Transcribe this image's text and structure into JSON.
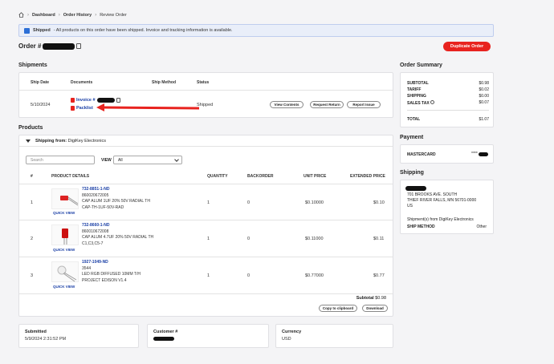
{
  "breadcrumb": {
    "home_icon": "home-icon",
    "dashboard": "Dashboard",
    "order_history": "Order History",
    "current": "Review Order"
  },
  "banner": {
    "status": "Shipped",
    "message": "- All products on this order have been shipped. Invoice and tracking information is available."
  },
  "order": {
    "title_prefix": "Order #",
    "duplicate_label": "Duplicate Order"
  },
  "shipments": {
    "title": "Shipments",
    "headers": {
      "ship_date": "Ship Date",
      "documents": "Documents",
      "ship_method": "Ship Method",
      "status": "Status"
    },
    "row": {
      "ship_date": "5/10/2024",
      "invoice_label": "Invoice #",
      "packlist_label": "Packlist",
      "status": "Shipped",
      "btn_view": "View Contents",
      "btn_return": "Request Return",
      "btn_issue": "Report Issue"
    }
  },
  "products": {
    "title": "Products",
    "shipping_from": "Shipping from:",
    "shipping_from_value": "DigiKey Electronics",
    "search_placeholder": "Search",
    "view_label": "VIEW",
    "view_value": "All",
    "headers": {
      "num": "#",
      "details": "PRODUCT DETAILS",
      "qty": "QUANTITY",
      "backorder": "BACKORDER",
      "unit": "UNIT PRICE",
      "ext": "EXTENDED PRICE"
    },
    "quick_view": "QUICK VIEW",
    "rows": [
      {
        "num": "1",
        "pn": "732-8851-1-ND",
        "mfr": "860020672005",
        "desc": "CAP ALUM 1UF 20% 50V RADIAL TH",
        "cust": "CAP-TH-1UF-50V-RAD",
        "qty": "1",
        "backorder": "0",
        "unit": "$0.10000",
        "ext": "$0.10"
      },
      {
        "num": "2",
        "pn": "732-8660-1-ND",
        "mfr": "860010672008",
        "desc": "CAP ALUM 4.7UF 20% 50V RADIAL TH",
        "cust": "C1,C3,C5-7",
        "qty": "1",
        "backorder": "0",
        "unit": "$0.11000",
        "ext": "$0.11"
      },
      {
        "num": "3",
        "pn": "1927-1049-ND",
        "mfr": "3544",
        "desc": "LED RGB DIFFUSED 10MM T/H",
        "cust": "PROJECT EDISON V1.4",
        "qty": "1",
        "backorder": "0",
        "unit": "$0.77000",
        "ext": "$0.77"
      }
    ],
    "subtotal_label": "Subtotal",
    "subtotal_value": "$0.98",
    "copy_label": "Copy to clipboard",
    "download_label": "Download"
  },
  "summary": {
    "title": "Order Summary",
    "rows": [
      {
        "label": "SUBTOTAL",
        "value": "$0.98"
      },
      {
        "label": "TARIFF",
        "value": "$0.02"
      },
      {
        "label": "SHIPPING",
        "value": "$0.00"
      },
      {
        "label": "SALES TAX",
        "value": "$0.07"
      }
    ],
    "total_label": "TOTAL",
    "total_value": "$1.07"
  },
  "payment": {
    "title": "Payment",
    "method": "MASTERCARD",
    "masked": "****"
  },
  "shipping": {
    "title": "Shipping",
    "addr1": "701 BROOKS AVE. SOUTH",
    "addr2": "THIEF RIVER FALLS, MN 56701-0000",
    "addr3": "US",
    "from_text": "Shipment(s) from DigiKey Electronics",
    "method_label": "SHIP METHOD",
    "method_value": "Other"
  },
  "footer": {
    "submitted_label": "Submitted",
    "submitted_value": "5/9/2024 2:31:52 PM",
    "customer_label": "Customer #",
    "currency_label": "Currency",
    "currency_value": "USD"
  },
  "colors": {
    "accent": "#e8231f",
    "link": "#1a3fa6",
    "banner_bg": "#e9eef9"
  }
}
